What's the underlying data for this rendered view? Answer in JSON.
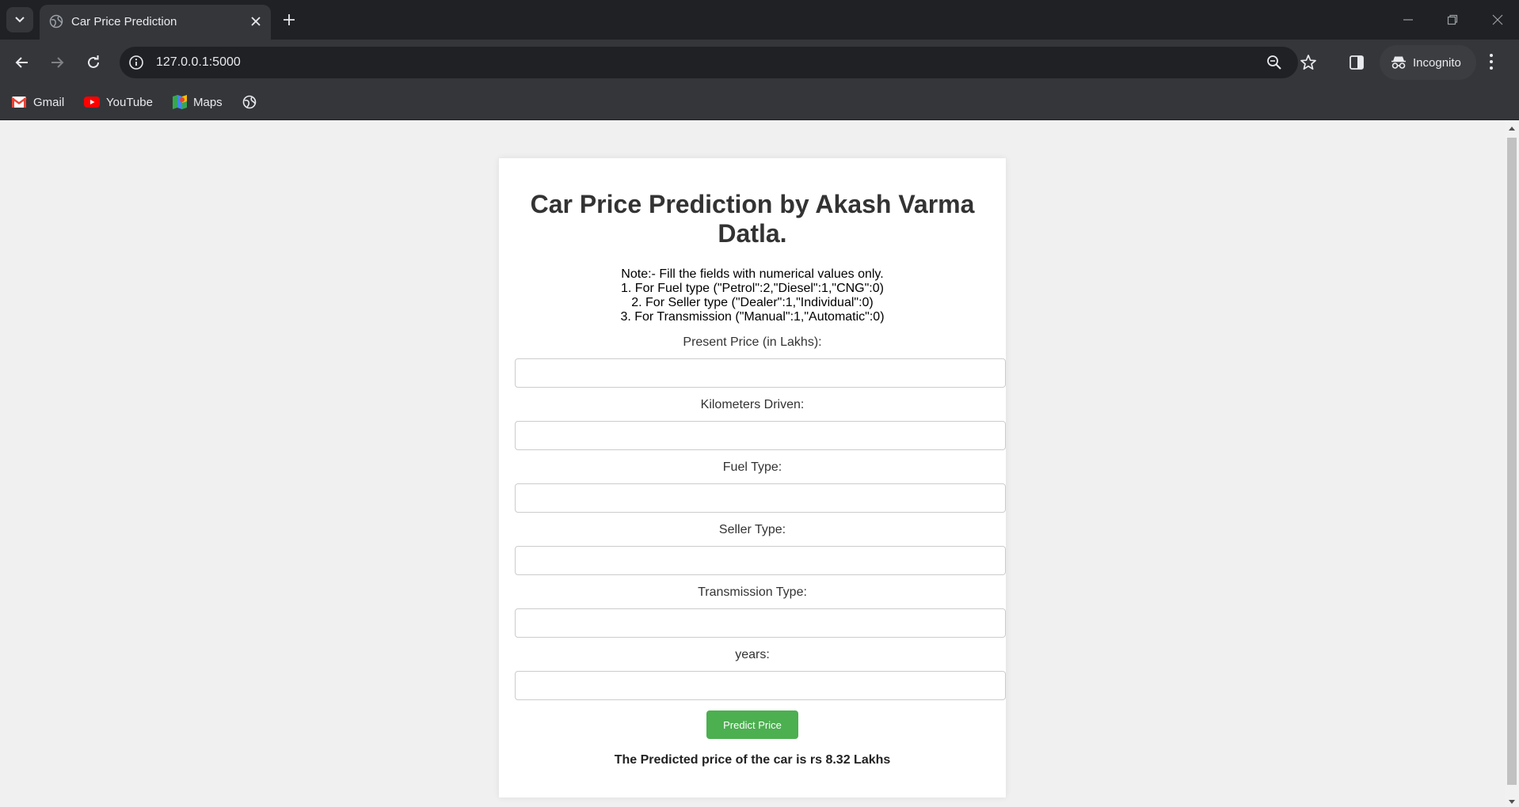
{
  "browser": {
    "tab_title": "Car Price Prediction",
    "url": "127.0.0.1:5000",
    "profile_label": "Incognito",
    "bookmarks": [
      {
        "label": "Gmail"
      },
      {
        "label": "YouTube"
      },
      {
        "label": "Maps"
      }
    ]
  },
  "page": {
    "title": "Car Price Prediction by Akash Varma Datla.",
    "note_lines": [
      "Note:- Fill the fields with numerical values only.",
      "1. For Fuel type (\"Petrol\":2,\"Diesel\":1,\"CNG\":0)",
      "2. For Seller type (\"Dealer\":1,\"Individual\":0)",
      "3. For Transmission (\"Manual\":1,\"Automatic\":0)"
    ],
    "fields": [
      {
        "label": "Present Price (in Lakhs):",
        "value": ""
      },
      {
        "label": "Kilometers Driven:",
        "value": ""
      },
      {
        "label": "Fuel Type:",
        "value": ""
      },
      {
        "label": "Seller Type:",
        "value": ""
      },
      {
        "label": "Transmission Type:",
        "value": ""
      },
      {
        "label": "years:",
        "value": ""
      }
    ],
    "predict_button": "Predict Price",
    "result": "The Predicted price of the car is rs 8.32 Lakhs"
  }
}
